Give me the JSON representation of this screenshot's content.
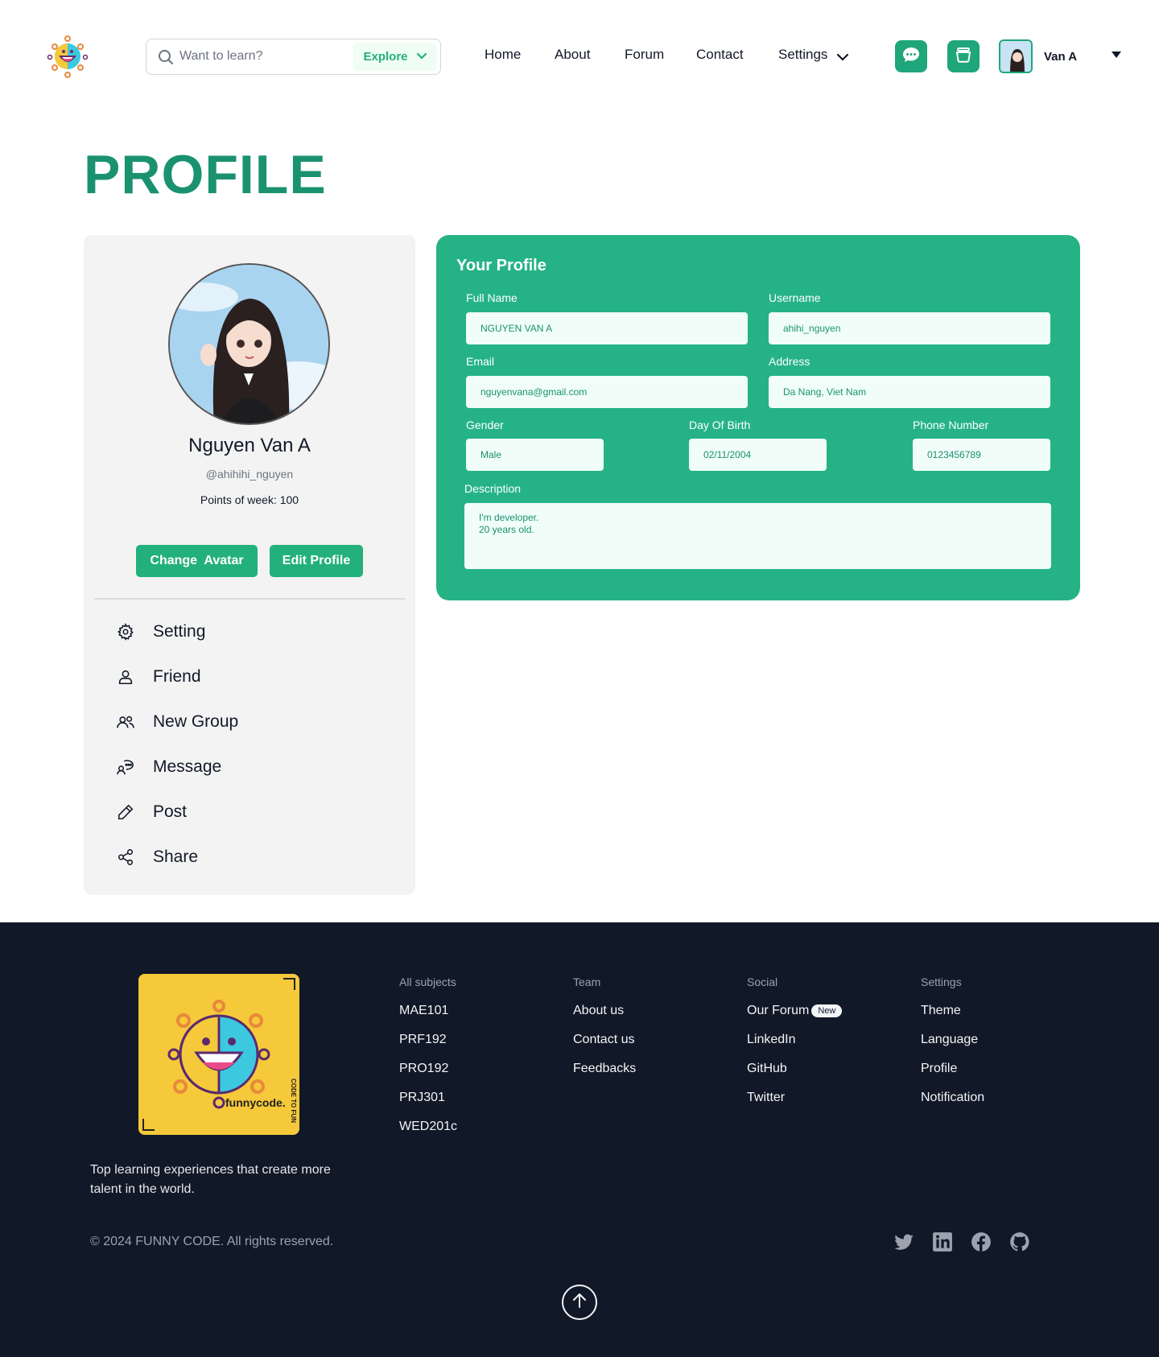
{
  "header": {
    "search_placeholder": "Want to learn?",
    "explore_label": "Explore",
    "nav": [
      "Home",
      "About",
      "Forum",
      "Contact",
      "Settings"
    ],
    "user_name": "Van A"
  },
  "page_title": "PROFILE",
  "profile_card": {
    "name": "Nguyen Van A",
    "username": "@ahihihi_nguyen",
    "points": "Points of week: 100",
    "change_avatar": "Change  Avatar",
    "edit_profile": "Edit Profile",
    "menu": [
      {
        "label": "Setting",
        "icon": "gear-icon"
      },
      {
        "label": "Friend",
        "icon": "user-icon"
      },
      {
        "label": "New Group",
        "icon": "users-icon"
      },
      {
        "label": "Message",
        "icon": "chat-icon"
      },
      {
        "label": "Post",
        "icon": "pencil-icon"
      },
      {
        "label": "Share",
        "icon": "share-icon"
      }
    ]
  },
  "form": {
    "title": "Your Profile",
    "full_name_label": "Full Name",
    "full_name": "NGUYEN VAN A",
    "username_label": "Username",
    "username": "ahihi_nguyen",
    "email_label": "Email",
    "email": "nguyenvana@gmail.com",
    "address_label": "Address",
    "address": "Da Nang, Viet Nam",
    "gender_label": "Gender",
    "gender": "Male",
    "dob_label": "Day Of Birth",
    "dob": "02/11/2004",
    "phone_label": "Phone Number",
    "phone": "0123456789",
    "description_label": "Description",
    "description": "I'm developer.\n20 years old."
  },
  "footer": {
    "tagline": "Top learning experiences that create more talent in the world.",
    "copyright": "© 2024 FUNNY CODE. All rights reserved.",
    "columns": [
      {
        "title": "All subjects",
        "links": [
          "MAE101",
          "PRF192",
          "PRO192",
          "PRJ301",
          "WED201c"
        ]
      },
      {
        "title": "Team",
        "links": [
          "About us",
          "Contact us",
          "Feedbacks"
        ]
      },
      {
        "title": "Social",
        "links": [
          "Our Forum",
          "LinkedIn",
          "GitHub",
          "Twitter"
        ]
      },
      {
        "title": "Settings",
        "links": [
          "Theme",
          "Language",
          "Profile",
          "Notification"
        ]
      }
    ],
    "new_badge": "New",
    "logo_text": "funnycode.",
    "logo_side": "CODE TO FUN",
    "social_icons": [
      "twitter-icon",
      "linkedin-icon",
      "facebook-icon",
      "github-icon"
    ]
  },
  "colors": {
    "brand": "#22b07d",
    "brand_dark": "#1a9270",
    "footer_bg": "#111827"
  }
}
